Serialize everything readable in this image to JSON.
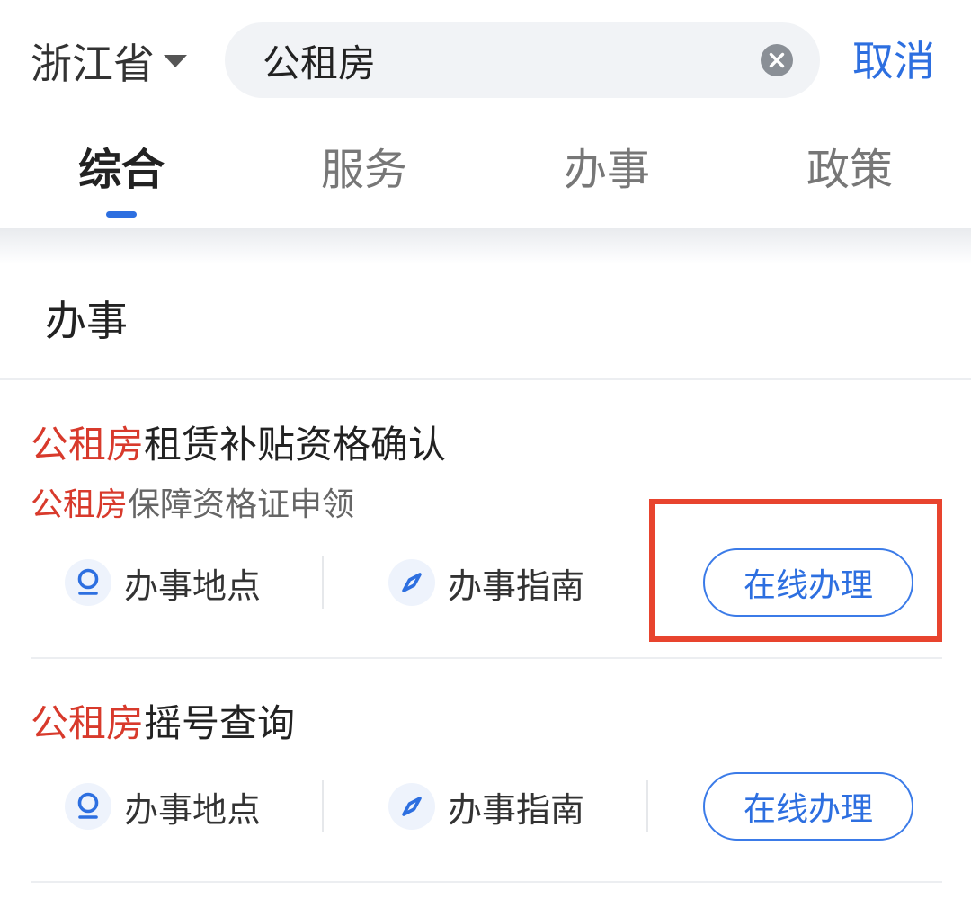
{
  "header": {
    "region": "浙江省",
    "search_value": "公租房",
    "cancel_label": "取消"
  },
  "tabs": [
    {
      "label": "综合",
      "active": true
    },
    {
      "label": "服务",
      "active": false
    },
    {
      "label": "办事",
      "active": false
    },
    {
      "label": "政策",
      "active": false
    }
  ],
  "section": {
    "title": "办事"
  },
  "items": [
    {
      "title_highlight": "公租房",
      "title_rest": "租赁补贴资格确认",
      "subtitle_highlight": "公租房",
      "subtitle_rest": "保障资格证申领",
      "location_label": "办事地点",
      "guide_label": "办事指南",
      "online_label": "在线办理"
    },
    {
      "title_highlight": "公租房",
      "title_rest": "摇号查询",
      "location_label": "办事地点",
      "guide_label": "办事指南",
      "online_label": "在线办理"
    }
  ],
  "colors": {
    "accent": "#2d6fe0",
    "highlight_text": "#d83a2c",
    "annotation_box": "#e8442e"
  },
  "icons": {
    "region_dropdown": "caret-down-icon",
    "clear": "clear-icon",
    "location": "location-pin-icon",
    "guide": "compass-icon"
  }
}
